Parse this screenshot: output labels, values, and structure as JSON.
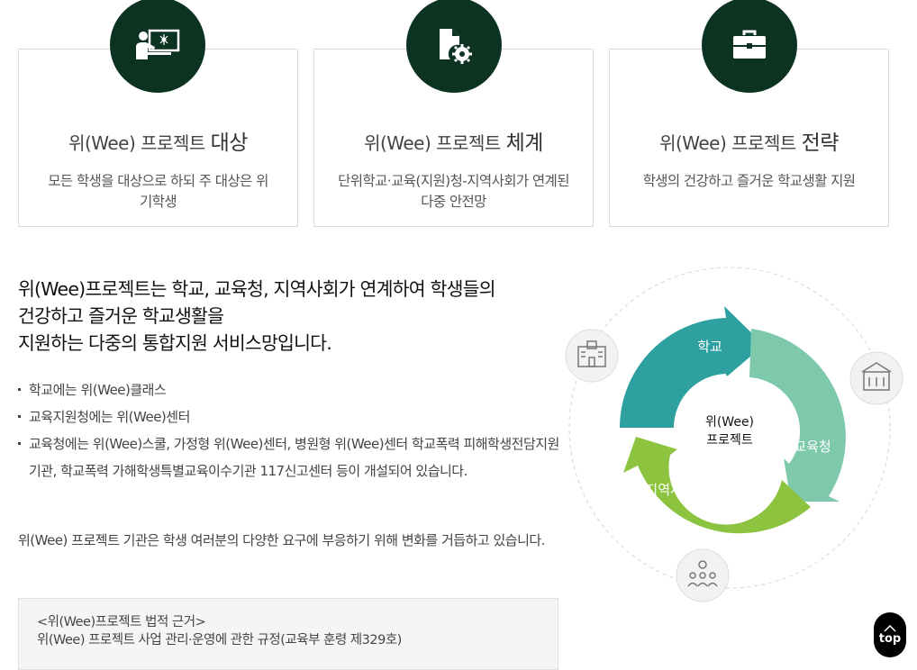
{
  "cards": [
    {
      "title_prefix": "위(Wee) 프로젝트",
      "title_emph": "대상",
      "desc": "모든 학생을 대상으로 하되 주 대상은 위기학생",
      "icon": "teacher-board-icon"
    },
    {
      "title_prefix": "위(Wee) 프로젝트",
      "title_emph": "체계",
      "desc": "단위학교·교육(지원)청-지역사회가 연계된 다중 안전망",
      "icon": "document-gear-icon"
    },
    {
      "title_prefix": "위(Wee) 프로젝트",
      "title_emph": "전략",
      "desc": "학생의 건강하고 즐거운 학교생활 지원",
      "icon": "briefcase-icon"
    }
  ],
  "intro": {
    "line1": "위(Wee)프로젝트는 학교, 교육청, 지역사회가 연계하여 학생들의",
    "line2": "건강하고 즐거운 학교생활을",
    "line3": "지원하는 다중의 통합지원 서비스망입니다."
  },
  "bullets": [
    "학교에는 위(Wee)클래스",
    "교육지원청에는 위(Wee)센터",
    "교육청에는 위(Wee)스쿨, 가정형 위(Wee)센터, 병원형 위(Wee)센터 학교폭력 피해학생전담지원기관, 학교폭력 가해학생특별교육이수기관 117신고센터 등이 개설되어 있습니다."
  ],
  "paragraph": "위(Wee) 프로젝트 기관은 학생 여러분의 다양한 요구에 부응하기 위해 변화를 거듭하고 있습니다.",
  "legal": {
    "heading": "<위(Wee)프로젝트 법적 근거>",
    "text": "위(Wee) 프로젝트 사업 관리·운영에 관한 규정(교육부 훈령 제329호)"
  },
  "diagram": {
    "center_line1": "위(Wee)",
    "center_line2": "프로젝트",
    "segments": [
      {
        "label": "학교",
        "color": "#2ea09f"
      },
      {
        "label": "교육청",
        "color": "#7ec8ac"
      },
      {
        "label": "지역사회",
        "color": "#8cc43f"
      }
    ],
    "icons": [
      "school-building-icon",
      "office-building-icon",
      "people-group-icon"
    ]
  },
  "top_button": {
    "label": "top"
  },
  "colors": {
    "dark_green": "#0c3322",
    "border": "#dcdcdc"
  }
}
